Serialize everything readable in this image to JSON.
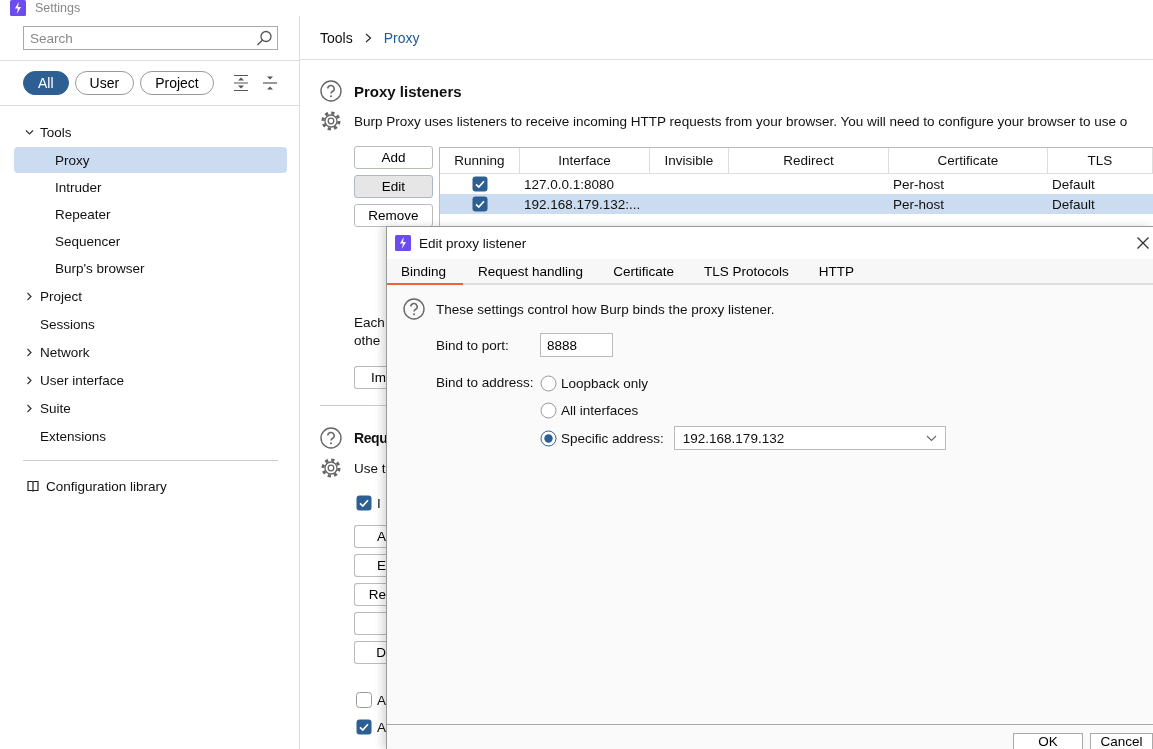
{
  "window": {
    "title": "Settings"
  },
  "sidebar": {
    "search": {
      "placeholder": "Search"
    },
    "filters": [
      {
        "label": "All",
        "selected": true
      },
      {
        "label": "User",
        "selected": false
      },
      {
        "label": "Project",
        "selected": false
      }
    ],
    "tree": [
      {
        "label": "Tools",
        "kind": "group",
        "expanded": true,
        "selected": false,
        "children": [
          {
            "label": "Proxy",
            "selected": true
          },
          {
            "label": "Intruder",
            "selected": false
          },
          {
            "label": "Repeater",
            "selected": false
          },
          {
            "label": "Sequencer",
            "selected": false
          },
          {
            "label": "Burp's browser",
            "selected": false
          }
        ]
      },
      {
        "label": "Project",
        "kind": "group",
        "expanded": false,
        "selected": false
      },
      {
        "label": "Sessions",
        "kind": "item",
        "selected": false
      },
      {
        "label": "Network",
        "kind": "group",
        "expanded": false,
        "selected": false
      },
      {
        "label": "User interface",
        "kind": "group",
        "expanded": false,
        "selected": false
      },
      {
        "label": "Suite",
        "kind": "group",
        "expanded": false,
        "selected": false
      },
      {
        "label": "Extensions",
        "kind": "item",
        "selected": false
      }
    ],
    "library_link": "Configuration library"
  },
  "breadcrumb": [
    {
      "label": "Tools",
      "kind": "crumb"
    },
    {
      "label": "Proxy",
      "kind": "current"
    }
  ],
  "proxy_listeners": {
    "title": "Proxy listeners",
    "description": "Burp Proxy uses listeners to receive incoming HTTP requests from your browser. You will need to configure your browser to use o",
    "buttons": [
      {
        "label": "Add",
        "active": false
      },
      {
        "label": "Edit",
        "active": true
      },
      {
        "label": "Remove",
        "active": false
      }
    ],
    "table": {
      "columns": [
        "Running",
        "Interface",
        "Invisible",
        "Redirect",
        "Certificate",
        "TLS"
      ],
      "rows": [
        {
          "running": true,
          "interface": "127.0.0.1:8080",
          "certificate": "Per-host",
          "tls": "Default",
          "selected": false
        },
        {
          "running": true,
          "interface": "192.168.179.132:...",
          "certificate": "Per-host",
          "tls": "Default",
          "selected": true
        }
      ]
    },
    "note_lines": [
      "Each",
      "othe"
    ],
    "import_button": "Im"
  },
  "request_section": {
    "title": "Requ",
    "description": "Use t",
    "option": {
      "label": "I",
      "checked": true
    },
    "buttons": [
      {
        "kind": "button",
        "label": "A"
      },
      {
        "kind": "button",
        "label": "E"
      },
      {
        "kind": "button",
        "label": "Re"
      },
      {
        "kind": "button"
      },
      {
        "kind": "button",
        "label": "D"
      }
    ],
    "checkboxes": [
      {
        "label": "A",
        "checked": false
      },
      {
        "label": "A",
        "checked": true
      }
    ]
  },
  "dialog": {
    "title": "Edit proxy listener",
    "tabs": [
      {
        "label": "Binding",
        "selected": true
      },
      {
        "label": "Request handling",
        "selected": false
      },
      {
        "label": "Certificate",
        "selected": false
      },
      {
        "label": "TLS Protocols",
        "selected": false
      },
      {
        "label": "HTTP",
        "selected": false
      }
    ],
    "help": "These settings control how Burp binds the proxy listener.",
    "port": {
      "label": "Bind to port:",
      "value": "8888"
    },
    "address": {
      "label": "Bind to address:",
      "options": [
        {
          "label": "Loopback only",
          "selected": false
        },
        {
          "label": "All interfaces",
          "selected": false
        },
        {
          "label": "Specific address:",
          "selected": true
        }
      ],
      "specific_value": "192.168.179.132"
    },
    "buttons": [
      "OK",
      "Cancel"
    ]
  }
}
